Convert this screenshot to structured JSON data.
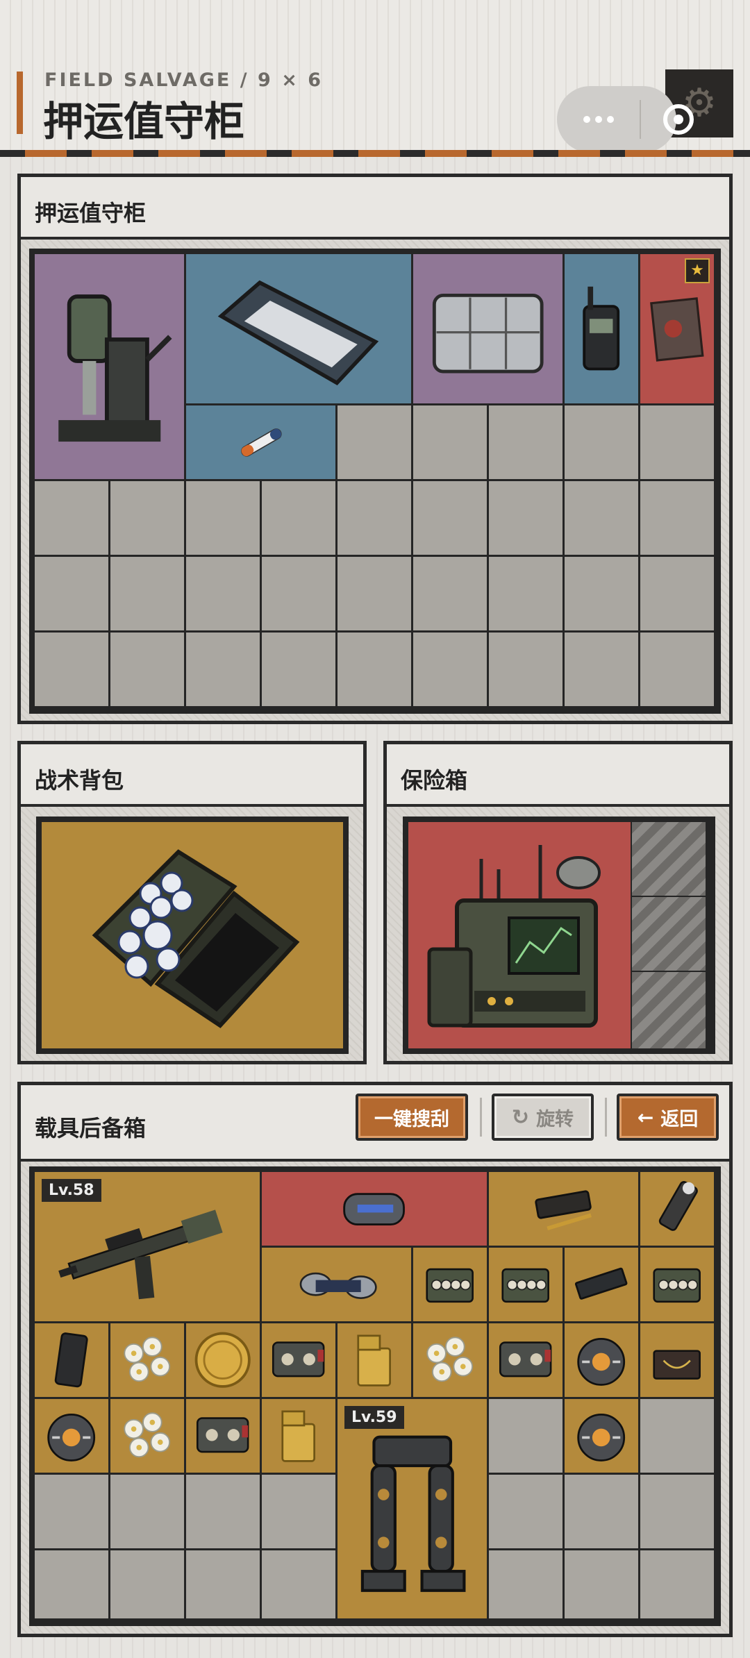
{
  "header": {
    "subtitle": "FIELD SALVAGE / 9 × 6",
    "title": "押运值守柜",
    "accent_color": "#b8682e"
  },
  "capsule": {
    "more_icon": "more-dots-icon",
    "close_icon": "record-circle-icon"
  },
  "sections": {
    "locker": {
      "title": "押运值守柜",
      "items": [
        {
          "name": "magnetic-drill-press",
          "color": "purple"
        },
        {
          "name": "blueprint-tube-case",
          "color": "blue"
        },
        {
          "name": "parts-organizer-box",
          "color": "purple"
        },
        {
          "name": "walkie-talkie",
          "color": "blue"
        },
        {
          "name": "burnt-document",
          "color": "red",
          "starred": true
        },
        {
          "name": "syringe-injector",
          "color": "blue"
        }
      ]
    },
    "backpack": {
      "title": "战术背包",
      "items": [
        {
          "name": "tea-set-case",
          "color": "gold"
        }
      ]
    },
    "safe": {
      "title": "保险箱",
      "items": [
        {
          "name": "radio-station-terminal",
          "color": "red"
        }
      ]
    },
    "vehicle": {
      "title": "载具后备箱",
      "buttons": {
        "loot_all": "一键搜刮",
        "rotate": "旋转",
        "back": "返回"
      },
      "items": [
        {
          "name": "assault-rifle",
          "level": "Lv.58"
        },
        {
          "name": "power-core-cylinder"
        },
        {
          "name": "fountain-pen-case"
        },
        {
          "name": "flashlight-bundle"
        },
        {
          "name": "film-reel-tape"
        },
        {
          "name": "ammo-box-1"
        },
        {
          "name": "ammo-box-2"
        },
        {
          "name": "ssd-drive"
        },
        {
          "name": "ammo-box-3"
        },
        {
          "name": "smartphone"
        },
        {
          "name": "white-flowers-1"
        },
        {
          "name": "gold-coin"
        },
        {
          "name": "cassette-tape-1"
        },
        {
          "name": "gold-lighter-1"
        },
        {
          "name": "white-flowers-2"
        },
        {
          "name": "cassette-tape-2"
        },
        {
          "name": "reactor-core-1"
        },
        {
          "name": "jewelry-box"
        },
        {
          "name": "reactor-core-2"
        },
        {
          "name": "white-flowers-3"
        },
        {
          "name": "cassette-tape-3"
        },
        {
          "name": "gold-lighter-2"
        },
        {
          "name": "exoskeleton-legs",
          "level": "Lv.59"
        },
        {
          "name": "reactor-core-3"
        }
      ]
    }
  }
}
